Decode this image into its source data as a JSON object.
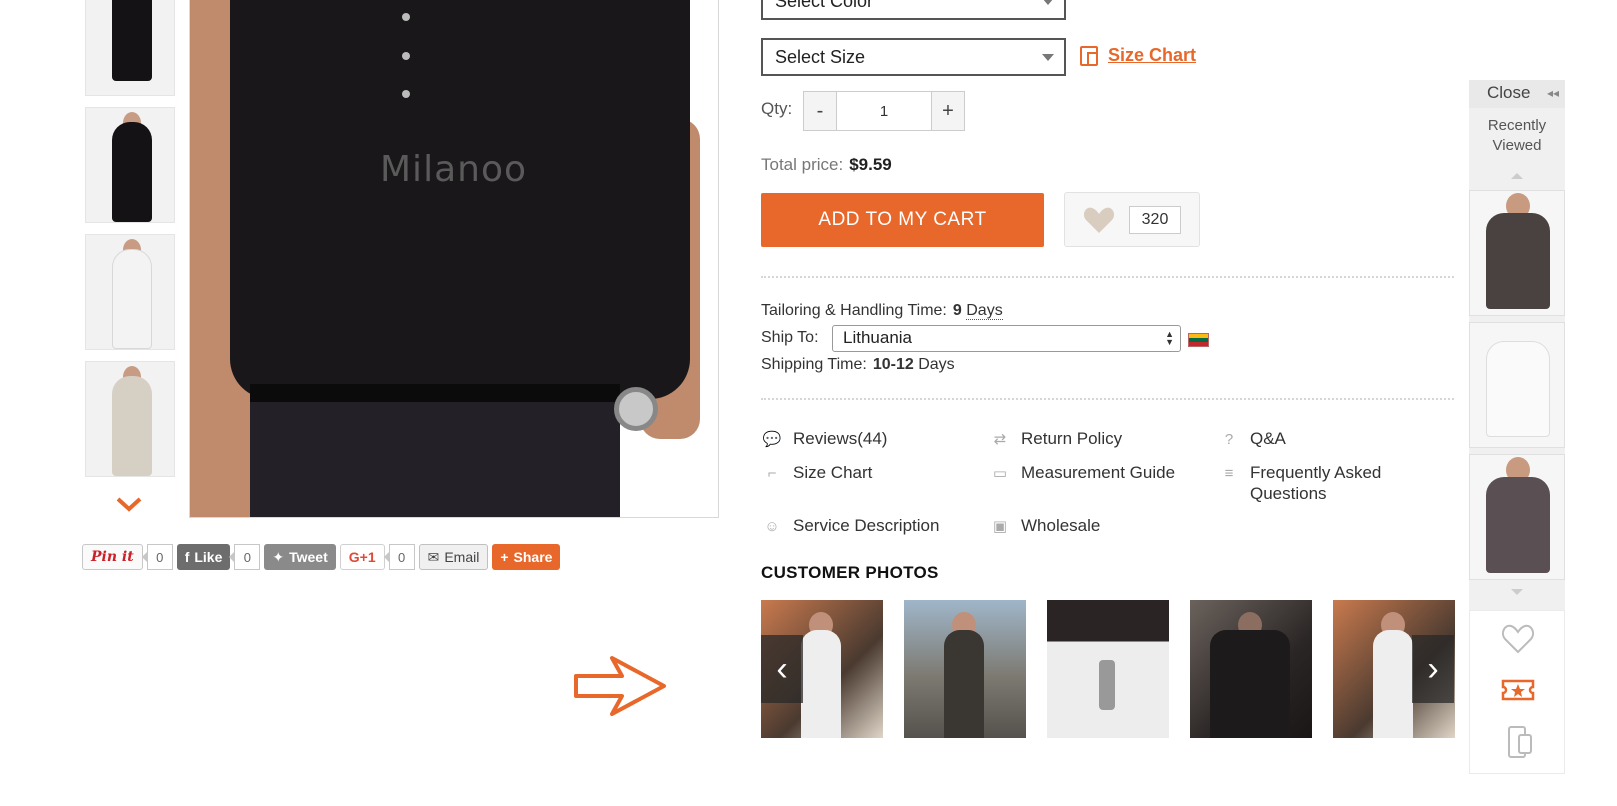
{
  "gallery": {
    "thumbnails": [
      {
        "alt": "thumbnail-front-black"
      },
      {
        "alt": "thumbnail-side-black"
      },
      {
        "alt": "thumbnail-front-white"
      },
      {
        "alt": "thumbnail-beige-crossed-arms"
      }
    ],
    "watermark": "Milanoo"
  },
  "share": {
    "pinit": "Pin it",
    "pin_count": "0",
    "like": "Like",
    "like_count": "0",
    "tweet": "Tweet",
    "gplus": "G+1",
    "gplus_count": "0",
    "email": "Email",
    "share": "Share"
  },
  "options": {
    "color_placeholder": "Select Color",
    "size_placeholder": "Select Size",
    "size_chart_link": "Size Chart"
  },
  "quantity": {
    "label": "Qty:",
    "minus": "-",
    "value": "1",
    "plus": "+"
  },
  "price": {
    "label": "Total price:",
    "value": "$9.59"
  },
  "actions": {
    "add_to_cart": "ADD TO MY CART",
    "wishlist_count": "320"
  },
  "shipping": {
    "tailoring_label": "Tailoring & Handling Time:",
    "tailoring_value": "9",
    "tailoring_unit": "Days",
    "ship_to_label": "Ship To:",
    "country": "Lithuania",
    "shipping_time_label": "Shipping Time:",
    "shipping_time_value": "10-12",
    "shipping_time_unit": "Days"
  },
  "info_links": [
    {
      "label": "Reviews(44)",
      "icon": "speech-bubble-icon"
    },
    {
      "label": "Return Policy",
      "icon": "return-arrows-icon"
    },
    {
      "label": "Q&A",
      "icon": "question-icon"
    },
    {
      "label": "Size Chart",
      "icon": "ruler-icon"
    },
    {
      "label": "Measurement Guide",
      "icon": "tape-measure-icon"
    },
    {
      "label": "Frequently Asked Questions",
      "icon": "faq-icon"
    },
    {
      "label": "Service Description",
      "icon": "smiley-icon"
    },
    {
      "label": "Wholesale",
      "icon": "box-icon"
    }
  ],
  "customer_photos": {
    "title": "CUSTOMER PHOTOS",
    "prev": "‹",
    "next": "›"
  },
  "recently_viewed": {
    "close": "Close",
    "title_line1": "Recently",
    "title_line2": "Viewed"
  },
  "colors": {
    "accent": "#e8672a",
    "text": "#333333"
  }
}
